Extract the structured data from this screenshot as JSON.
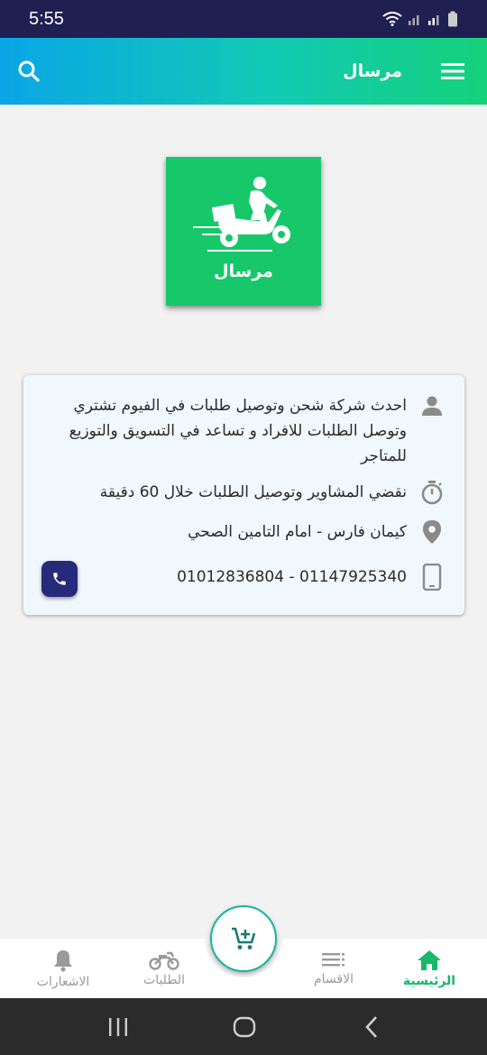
{
  "status_bar": {
    "time": "5:55"
  },
  "app_bar": {
    "title": "مرسال"
  },
  "logo": {
    "text": "مرسال"
  },
  "info": {
    "description": "احدث شركة شحن وتوصيل طلبات في الفيوم تشتري وتوصل الطلبات للافراد و تساعد في التسويق والتوزيع للمتاجر",
    "delivery_time": "نقضي المشاوير وتوصيل الطلبات خلال 60 دقيقة",
    "address": "كيمان فارس - امام التامين الصحي",
    "phones": "01147925340 - 01012836804"
  },
  "bottom_nav": {
    "items": [
      {
        "label": "الرئيسية",
        "icon": "home-icon",
        "active": true
      },
      {
        "label": "الاقسام",
        "icon": "categories-icon",
        "active": false
      },
      {
        "label": "الطلبات",
        "icon": "motorcycle-icon",
        "active": false
      },
      {
        "label": "الاشعارات",
        "icon": "bell-icon",
        "active": false
      }
    ],
    "fab_icon": "add-to-cart-icon"
  },
  "colors": {
    "status_bar": "#1f1f52",
    "accent_green": "#16c86a",
    "call_button": "#272a7a",
    "card_bg": "#f0f8fd"
  }
}
